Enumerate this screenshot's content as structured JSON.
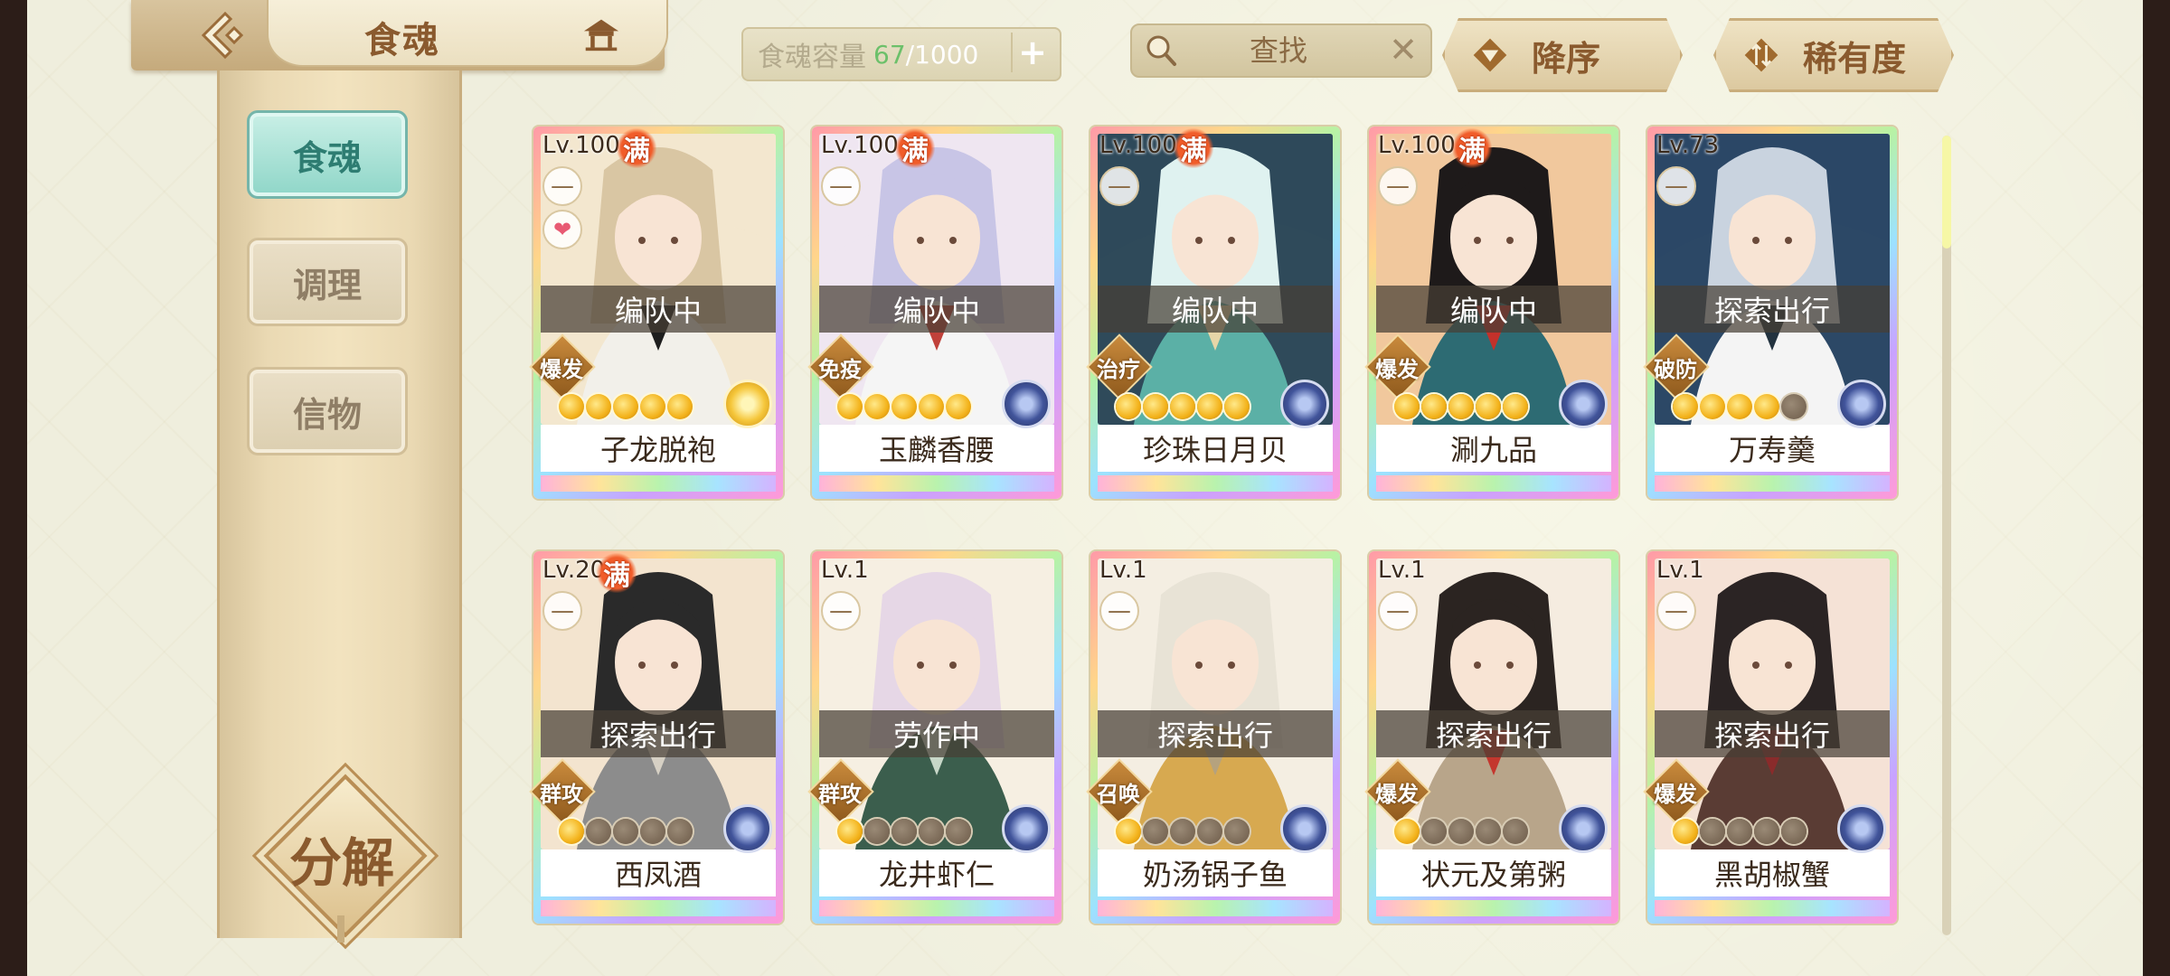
{
  "header": {
    "title": "食魂",
    "capacity_label": "食魂容量",
    "capacity_current": "67",
    "capacity_max": "/1000",
    "add_label": "+",
    "search_placeholder": "查找",
    "clear_label": "✕",
    "sort_order_label": "降序",
    "sort_rarity_label": "稀有度"
  },
  "sidebar": {
    "items": [
      {
        "label": "食魂",
        "active": true
      },
      {
        "label": "调理",
        "active": false
      },
      {
        "label": "信物",
        "active": false
      }
    ],
    "decompose_label": "分解"
  },
  "man_label": "满",
  "lock_label": "—",
  "cards": [
    {
      "level": "Lv.100",
      "maxed": true,
      "liked": true,
      "status": "编队中",
      "role": "爆发",
      "stars": 5,
      "element": "gold",
      "name": "子龙脱袍",
      "palette": [
        "#f3e7cf",
        "#d9c6a3",
        "#f2f0ea",
        "#1e1e1e"
      ]
    },
    {
      "level": "Lv.100",
      "maxed": true,
      "liked": false,
      "status": "编队中",
      "role": "免疫",
      "stars": 5,
      "element": "blue",
      "name": "玉麟香腰",
      "palette": [
        "#efe6f1",
        "#c8c5e6",
        "#f5f5f5",
        "#c0413a"
      ]
    },
    {
      "level": "Lv.100",
      "maxed": true,
      "liked": false,
      "status": "编队中",
      "role": "治疗",
      "stars": 5,
      "element": "blue",
      "name": "珍珠日月贝",
      "palette": [
        "#2f4a5a",
        "#dff2f0",
        "#5bb0a6",
        "#e7d6a8"
      ]
    },
    {
      "level": "Lv.100",
      "maxed": true,
      "liked": false,
      "status": "编队中",
      "role": "爆发",
      "stars": 5,
      "element": "blue",
      "name": "涮九品",
      "palette": [
        "#f1c89d",
        "#1e1a1a",
        "#2d6b73",
        "#c3312b"
      ]
    },
    {
      "level": "Lv.73",
      "maxed": false,
      "liked": false,
      "status": "探索出行",
      "role": "破防",
      "stars": 4,
      "element": "blue",
      "name": "万寿羹",
      "palette": [
        "#2c4866",
        "#c9d3df",
        "#f4f4f4",
        "#22323f"
      ]
    },
    {
      "level": "Lv.20",
      "maxed": true,
      "liked": false,
      "status": "探索出行",
      "role": "群攻",
      "stars": 1,
      "element": "blue",
      "name": "西凤酒",
      "palette": [
        "#f3e4cf",
        "#2a2a2a",
        "#8c8c8c",
        "#d6d0c4"
      ]
    },
    {
      "level": "Lv.1",
      "maxed": false,
      "liked": false,
      "status": "劳作中",
      "role": "群攻",
      "stars": 1,
      "element": "blue",
      "name": "龙井虾仁",
      "palette": [
        "#f6efe2",
        "#e6d7e6",
        "#3b5e4d",
        "#c7d7c8"
      ]
    },
    {
      "level": "Lv.1",
      "maxed": false,
      "liked": false,
      "status": "探索出行",
      "role": "召唤",
      "stars": 1,
      "element": "blue",
      "name": "奶汤锅子鱼",
      "palette": [
        "#f4eee2",
        "#e8e3d6",
        "#d7a950",
        "#b5a27e"
      ]
    },
    {
      "level": "Lv.1",
      "maxed": false,
      "liked": false,
      "status": "探索出行",
      "role": "爆发",
      "stars": 1,
      "element": "blue",
      "name": "状元及第粥",
      "palette": [
        "#f5ece0",
        "#2b2421",
        "#b8a58a",
        "#c4372e"
      ]
    },
    {
      "level": "Lv.1",
      "maxed": false,
      "liked": false,
      "status": "探索出行",
      "role": "爆发",
      "stars": 1,
      "element": "blue",
      "name": "黑胡椒蟹",
      "palette": [
        "#f5e2d6",
        "#2b2424",
        "#5a3c34",
        "#8a2b2b"
      ]
    }
  ]
}
